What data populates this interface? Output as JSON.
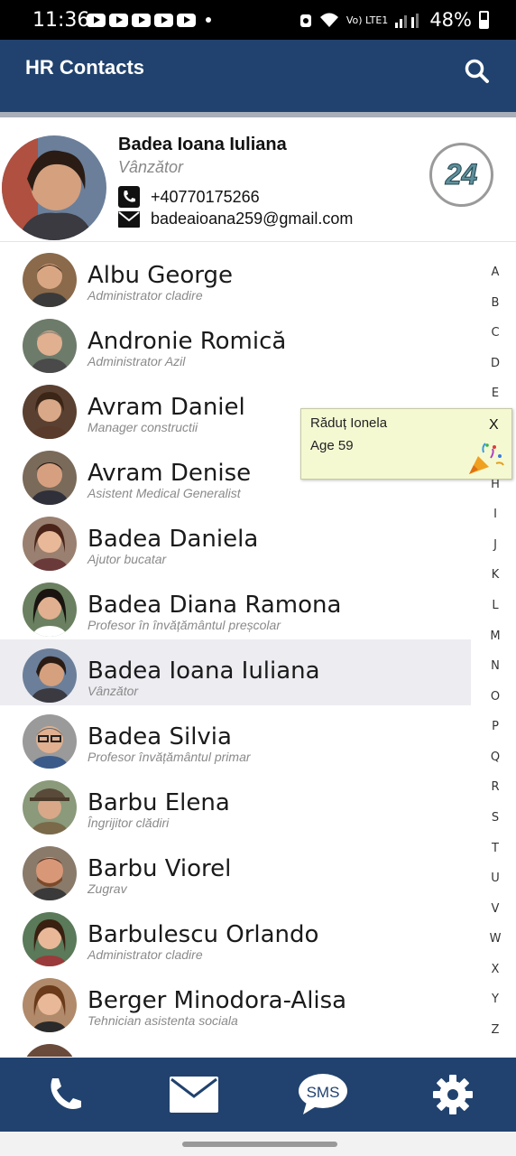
{
  "status_bar": {
    "time": "11:36",
    "network": "Vo) LTE1",
    "battery": "48%",
    "icons": [
      "youtube-icon",
      "youtube-icon",
      "youtube-icon",
      "youtube-icon",
      "youtube-icon",
      "notification-dot-icon",
      "alarm-icon",
      "wifi-icon",
      "signal-icon",
      "battery-icon"
    ]
  },
  "app_bar": {
    "title": "HR Contacts",
    "search_icon": "search-icon"
  },
  "profile": {
    "name": "Badea Ioana Iuliana",
    "role": "Vânzător",
    "phone": "+40770175266",
    "email": "badeaioana259@gmail.com",
    "badge": "24"
  },
  "contacts": [
    {
      "name": "Albu George",
      "job": "Administrator cladire"
    },
    {
      "name": "Andronie Romică",
      "job": "Administrator Azil"
    },
    {
      "name": "Avram Daniel",
      "job": "Manager constructii"
    },
    {
      "name": "Avram Denise",
      "job": "Asistent Medical Generalist"
    },
    {
      "name": "Badea Daniela",
      "job": "Ajutor bucatar"
    },
    {
      "name": "Badea Diana Ramona",
      "job": "Profesor în învățământul preșcolar"
    },
    {
      "name": "Badea Ioana Iuliana",
      "job": "Vânzător",
      "selected": true
    },
    {
      "name": "Badea Silvia",
      "job": "Profesor învățământul primar"
    },
    {
      "name": "Barbu Elena",
      "job": "Îngrijitor clădiri"
    },
    {
      "name": "Barbu Viorel",
      "job": "Zugrav"
    },
    {
      "name": "Barbulescu Orlando",
      "job": "Administrator cladire"
    },
    {
      "name": "Berger Minodora-Alisa",
      "job": "Tehnician asistenta sociala"
    }
  ],
  "alphabet": [
    "A",
    "B",
    "C",
    "D",
    "E",
    "X",
    "H",
    "I",
    "J",
    "K",
    "L",
    "M",
    "N",
    "O",
    "P",
    "Q",
    "R",
    "S",
    "T",
    "U",
    "V",
    "W",
    "X",
    "Y",
    "Z"
  ],
  "birthday_popup": {
    "name": "Răduț Ionela",
    "age": "Age 59",
    "close": "X"
  },
  "bottom_bar": {
    "sms_label": "SMS",
    "icons": [
      "phone-icon",
      "mail-icon",
      "sms-icon",
      "settings-icon"
    ]
  },
  "colors": {
    "primary": "#21426e",
    "selected_row": "#ececf1",
    "popup_bg": "#f5f9d2"
  }
}
